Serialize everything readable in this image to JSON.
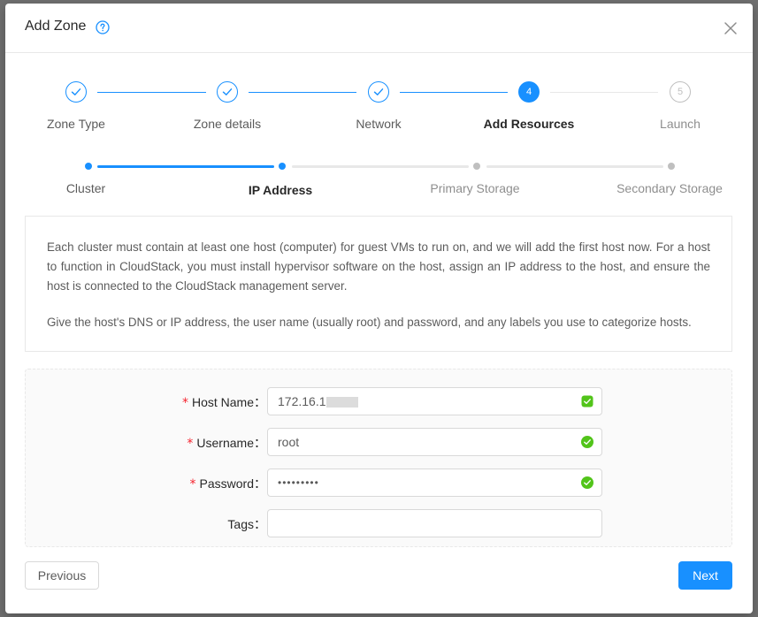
{
  "modal": {
    "title": "Add Zone",
    "help_icon": "question-circle-icon",
    "close_icon": "close-icon"
  },
  "steps": [
    {
      "label": "Zone Type",
      "status": "done"
    },
    {
      "label": "Zone details",
      "status": "done"
    },
    {
      "label": "Network",
      "status": "done"
    },
    {
      "label": "Add Resources",
      "status": "active",
      "number": "4"
    },
    {
      "label": "Launch",
      "status": "wait",
      "number": "5"
    }
  ],
  "substeps": [
    {
      "label": "Cluster",
      "status": "done"
    },
    {
      "label": "IP Address",
      "status": "active"
    },
    {
      "label": "Primary Storage",
      "status": "wait"
    },
    {
      "label": "Secondary Storage",
      "status": "wait"
    }
  ],
  "description": {
    "paragraph1": "Each cluster must contain at least one host (computer) for guest VMs to run on, and we will add the first host now. For a host to function in CloudStack, you must install hypervisor software on the host, assign an IP address to the host, and ensure the host is connected to the CloudStack management server.",
    "paragraph2": "Give the host's DNS or IP address, the user name (usually root) and password, and any labels you use to categorize hosts."
  },
  "form": {
    "host_name": {
      "label": "Host Name",
      "value": "172.16.1",
      "required": true
    },
    "username": {
      "label": "Username",
      "value": "root",
      "required": true
    },
    "password": {
      "label": "Password",
      "value": "•••••••••",
      "required": true
    },
    "tags": {
      "label": "Tags",
      "value": "",
      "required": false
    },
    "label_suffix": "：",
    "required_mark": "*"
  },
  "buttons": {
    "previous": "Previous",
    "next": "Next"
  },
  "colors": {
    "primary": "#1890ff",
    "success": "#52c41a",
    "required": "#f5222d"
  }
}
